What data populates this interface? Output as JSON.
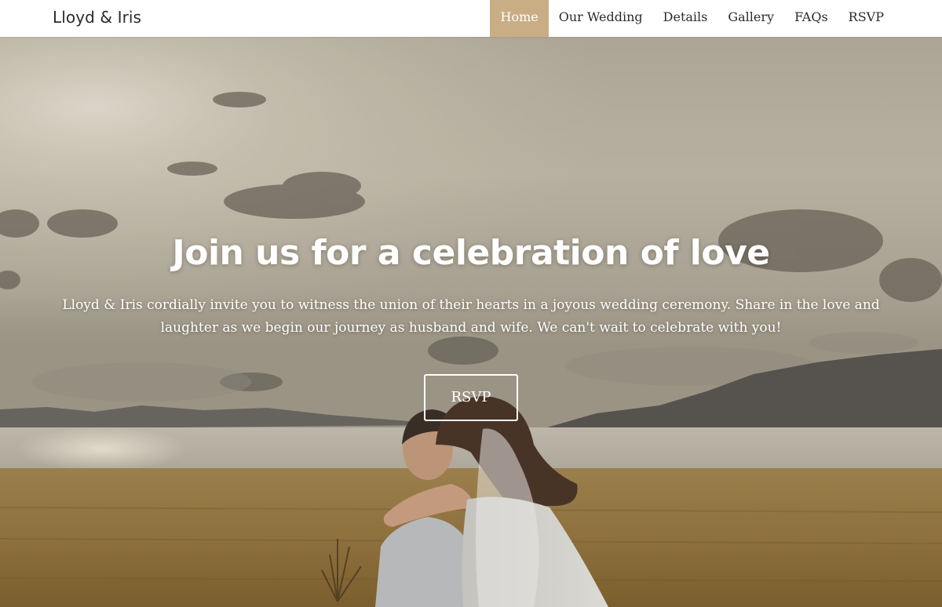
{
  "nav": {
    "brand": "Lloyd & Iris",
    "items": [
      {
        "label": "Home",
        "active": true
      },
      {
        "label": "Our Wedding",
        "active": false
      },
      {
        "label": "Details",
        "active": false
      },
      {
        "label": "Gallery",
        "active": false
      },
      {
        "label": "FAQs",
        "active": false
      },
      {
        "label": "RSVP",
        "active": false
      }
    ]
  },
  "hero": {
    "title": "Join us for a celebration of love",
    "text": "Lloyd & Iris cordially invite you to witness the union of their hearts in a joyous wedding ceremony. Share in the love and laughter as we begin our journey as husband and wife. We can't wait to celebrate with you!",
    "button_label": "RSVP",
    "image": "couple-by-lake-photo"
  },
  "colors": {
    "accent": "#c9ad84",
    "nav_background": "#ffffff",
    "nav_text": "#2b2b2b",
    "hero_text": "#ffffff"
  }
}
